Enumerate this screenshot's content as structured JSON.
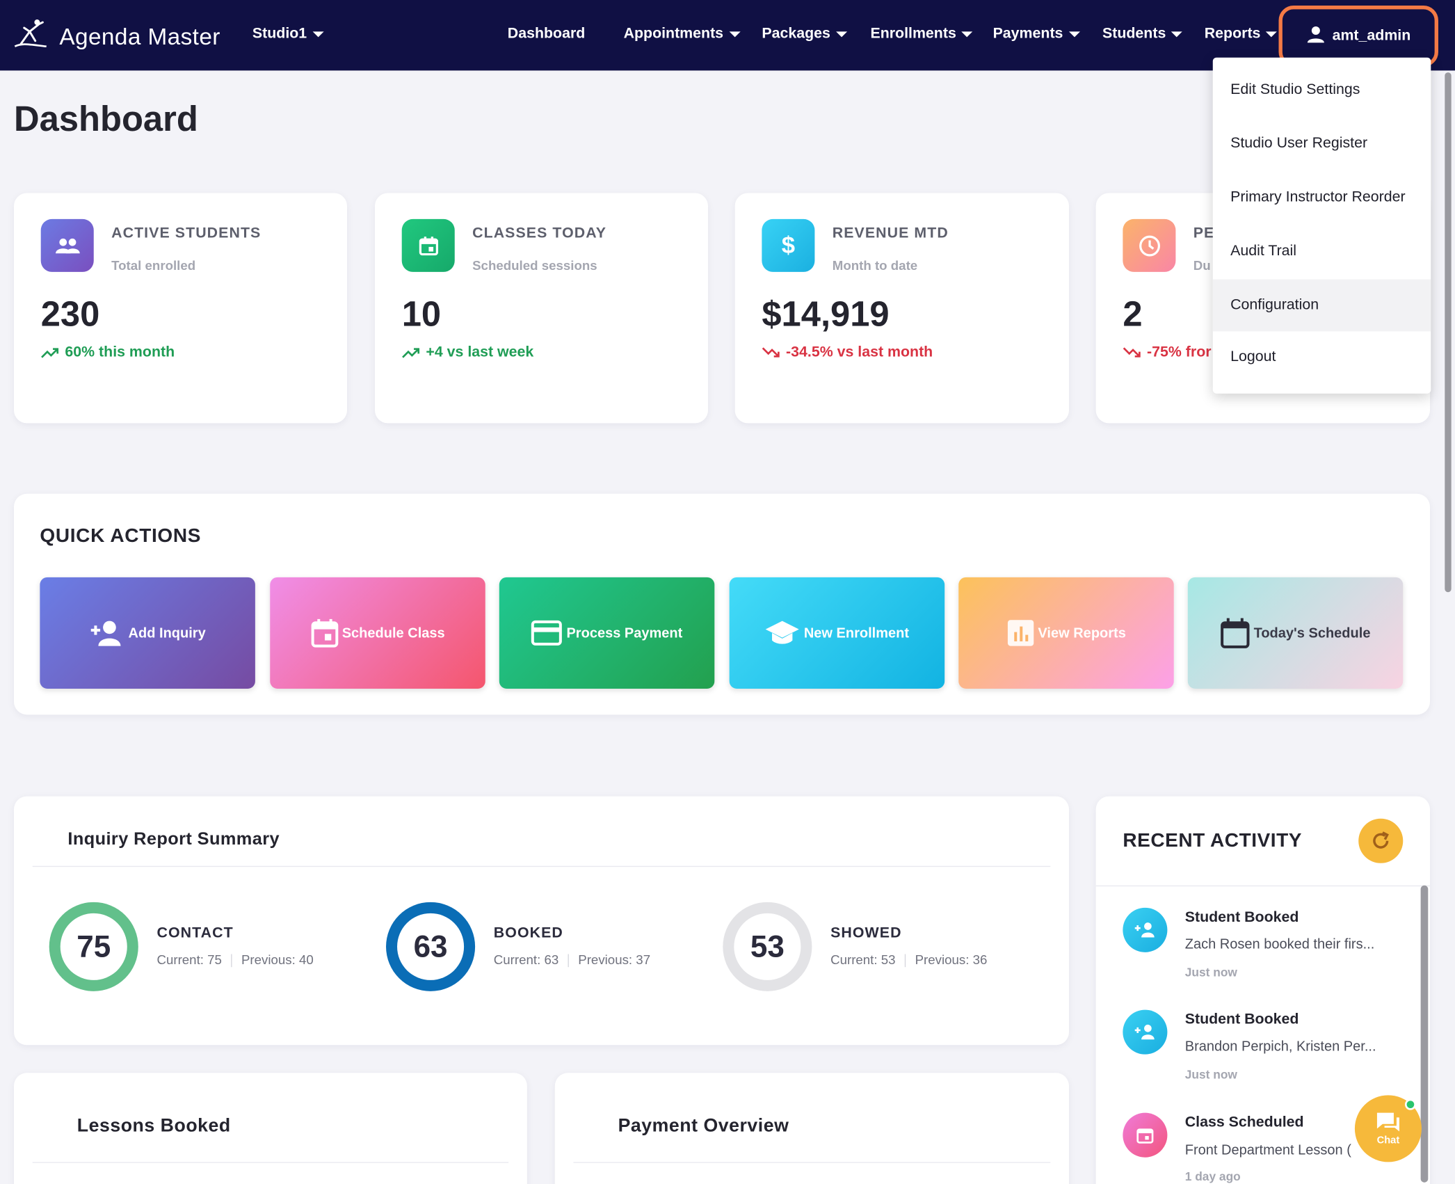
{
  "app": {
    "brand": "Agenda Master",
    "studio": "Studio1"
  },
  "nav": {
    "items": [
      "Dashboard",
      "Appointments",
      "Packages",
      "Enrollments",
      "Payments",
      "Students",
      "Reports"
    ],
    "user": "amt_admin"
  },
  "user_menu": {
    "items": [
      "Edit Studio Settings",
      "Studio User Register",
      "Primary Instructor Reorder",
      "Audit Trail",
      "Configuration",
      "Logout"
    ],
    "highlighted": "Configuration"
  },
  "page": {
    "title": "Dashboard"
  },
  "stats": [
    {
      "label": "ACTIVE STUDENTS",
      "sub": "Total enrolled",
      "value": "230",
      "trend": "60% this month",
      "direction": "up",
      "icon": "people-icon",
      "color": "#6a5ecb"
    },
    {
      "label": "CLASSES TODAY",
      "sub": "Scheduled sessions",
      "value": "10",
      "trend": "+4 vs last week",
      "direction": "up",
      "icon": "calendar-icon",
      "color": "#1fbf77"
    },
    {
      "label": "REVENUE MTD",
      "sub": "Month to date",
      "value": "$14,919",
      "trend": "-34.5% vs last month",
      "direction": "down",
      "icon": "dollar-icon",
      "color": "#2cc3ea"
    },
    {
      "label": "PE",
      "sub": "Du",
      "value": "2",
      "trend": "-75% fror",
      "direction": "down",
      "icon": "clock-icon",
      "color": "#f99a73"
    }
  ],
  "quick_actions": {
    "title": "QUICK ACTIONS",
    "items": [
      {
        "label": "Add Inquiry",
        "icon": "add-user-icon"
      },
      {
        "label": "Schedule Class",
        "icon": "calendar-icon"
      },
      {
        "label": "Process Payment",
        "icon": "credit-card-icon"
      },
      {
        "label": "New Enrollment",
        "icon": "graduation-cap-icon"
      },
      {
        "label": "View Reports",
        "icon": "bar-chart-icon"
      },
      {
        "label": "Today's Schedule",
        "icon": "calendar-icon"
      }
    ]
  },
  "inquiry": {
    "title": "Inquiry Report Summary",
    "metrics": [
      {
        "value": "75",
        "label": "CONTACT",
        "current": "Current: 75",
        "previous": "Previous: 40",
        "color": "#62c08b"
      },
      {
        "value": "63",
        "label": "BOOKED",
        "current": "Current: 63",
        "previous": "Previous: 37",
        "color": "#0a6db6"
      },
      {
        "value": "53",
        "label": "SHOWED",
        "current": "Current: 53",
        "previous": "Previous: 36",
        "color": "#e3e3e6"
      }
    ]
  },
  "recent_activity": {
    "title": "RECENT ACTIVITY",
    "items": [
      {
        "title": "Student Booked",
        "desc": "Zach Rosen booked their firs...",
        "time": "Just now",
        "icon": "add-user-icon"
      },
      {
        "title": "Student Booked",
        "desc": "Brandon Perpich, Kristen Per...",
        "time": "Just now",
        "icon": "add-user-icon"
      },
      {
        "title": "Class Scheduled",
        "desc": "Front Department Lesson (",
        "time": "1 day ago",
        "icon": "calendar-icon"
      }
    ]
  },
  "lessons": {
    "title": "Lessons Booked"
  },
  "payments": {
    "title": "Payment Overview"
  },
  "chat": {
    "label": "Chat"
  }
}
